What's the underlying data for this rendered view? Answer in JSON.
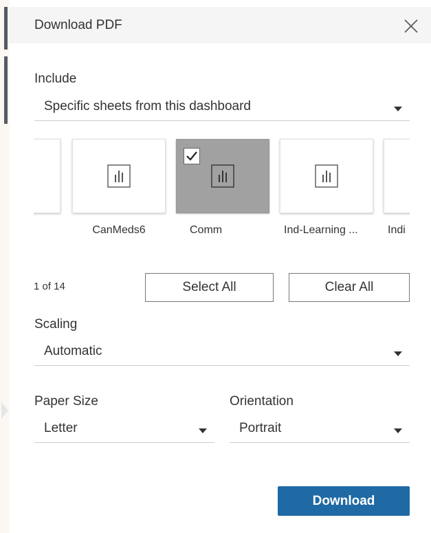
{
  "dialog": {
    "title": "Download PDF",
    "close_icon": "close-icon"
  },
  "include": {
    "label": "Include",
    "selected": "Specific sheets from this dashboard"
  },
  "sheets": {
    "items": [
      {
        "label": "",
        "selected": false
      },
      {
        "label": "CanMeds6",
        "selected": false
      },
      {
        "label": "Comm",
        "selected": true
      },
      {
        "label": "Ind-Learning ...",
        "selected": false
      },
      {
        "label": "Indi",
        "selected": false
      }
    ],
    "thumbnail_icon": "bar-chart-icon",
    "check_icon": "checkmark-icon"
  },
  "selection": {
    "count_text": "1 of 14",
    "select_all_label": "Select All",
    "clear_all_label": "Clear All"
  },
  "scaling": {
    "label": "Scaling",
    "selected": "Automatic"
  },
  "paper_size": {
    "label": "Paper Size",
    "selected": "Letter"
  },
  "orientation": {
    "label": "Orientation",
    "selected": "Portrait"
  },
  "actions": {
    "download_label": "Download"
  },
  "colors": {
    "primary": "#1f6aa5",
    "selected_thumb": "#a1a1a1",
    "header_bg": "#f5f5f5"
  }
}
